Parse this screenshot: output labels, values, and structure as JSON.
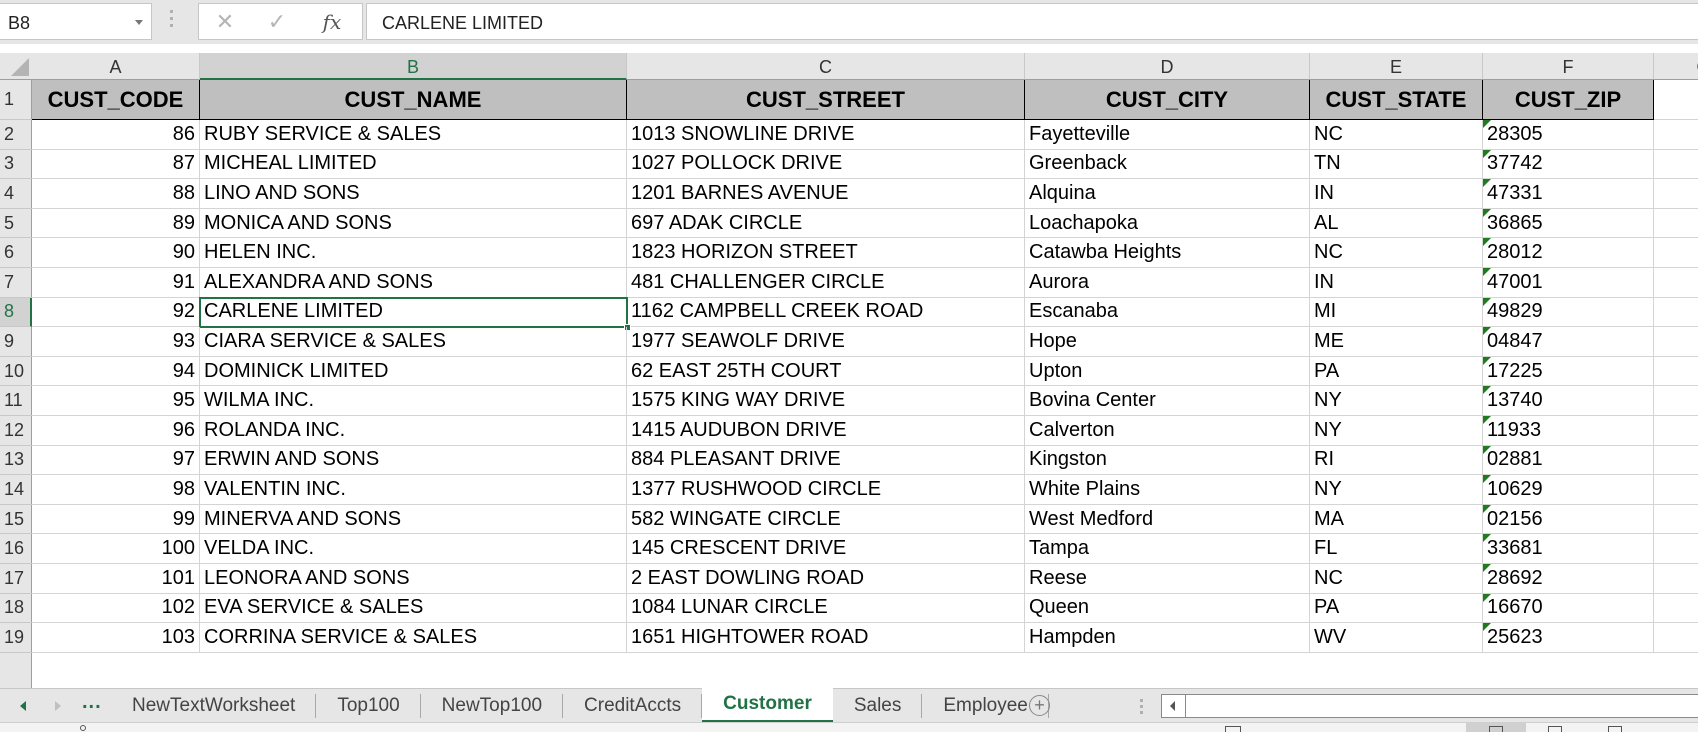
{
  "formula_bar": {
    "name_box": "B8",
    "cancel_icon": "✕",
    "enter_icon": "✓",
    "fx_label": "fx",
    "formula_value": "CARLENE LIMITED"
  },
  "grid": {
    "columns": [
      "A",
      "B",
      "C",
      "D",
      "E",
      "F",
      "G"
    ],
    "active_column": "B",
    "active_row": "8",
    "headers": [
      "CUST_CODE",
      "CUST_NAME",
      "CUST_STREET",
      "CUST_CITY",
      "CUST_STATE",
      "CUST_ZIP"
    ],
    "rows": [
      {
        "row": "2",
        "code": "86",
        "name": "RUBY SERVICE & SALES",
        "street": "1013 SNOWLINE DRIVE",
        "city": "Fayetteville",
        "state": "NC",
        "zip": "28305"
      },
      {
        "row": "3",
        "code": "87",
        "name": "MICHEAL LIMITED",
        "street": "1027 POLLOCK DRIVE",
        "city": "Greenback",
        "state": "TN",
        "zip": "37742"
      },
      {
        "row": "4",
        "code": "88",
        "name": "LINO AND SONS",
        "street": "1201 BARNES AVENUE",
        "city": "Alquina",
        "state": "IN",
        "zip": "47331"
      },
      {
        "row": "5",
        "code": "89",
        "name": "MONICA AND SONS",
        "street": "697 ADAK CIRCLE",
        "city": "Loachapoka",
        "state": "AL",
        "zip": "36865"
      },
      {
        "row": "6",
        "code": "90",
        "name": "HELEN INC.",
        "street": "1823 HORIZON STREET",
        "city": "Catawba Heights",
        "state": "NC",
        "zip": "28012"
      },
      {
        "row": "7",
        "code": "91",
        "name": "ALEXANDRA AND SONS",
        "street": "481 CHALLENGER CIRCLE",
        "city": "Aurora",
        "state": "IN",
        "zip": "47001"
      },
      {
        "row": "8",
        "code": "92",
        "name": "CARLENE LIMITED",
        "street": "1162 CAMPBELL CREEK ROAD",
        "city": "Escanaba",
        "state": "MI",
        "zip": "49829"
      },
      {
        "row": "9",
        "code": "93",
        "name": "CIARA SERVICE & SALES",
        "street": "1977 SEAWOLF DRIVE",
        "city": "Hope",
        "state": "ME",
        "zip": "04847"
      },
      {
        "row": "10",
        "code": "94",
        "name": "DOMINICK LIMITED",
        "street": "62 EAST 25TH COURT",
        "city": "Upton",
        "state": "PA",
        "zip": "17225"
      },
      {
        "row": "11",
        "code": "95",
        "name": "WILMA INC.",
        "street": "1575 KING WAY DRIVE",
        "city": "Bovina Center",
        "state": "NY",
        "zip": "13740"
      },
      {
        "row": "12",
        "code": "96",
        "name": "ROLANDA INC.",
        "street": "1415 AUDUBON DRIVE",
        "city": "Calverton",
        "state": "NY",
        "zip": "11933"
      },
      {
        "row": "13",
        "code": "97",
        "name": "ERWIN AND SONS",
        "street": "884 PLEASANT DRIVE",
        "city": "Kingston",
        "state": "RI",
        "zip": "02881"
      },
      {
        "row": "14",
        "code": "98",
        "name": "VALENTIN INC.",
        "street": "1377 RUSHWOOD CIRCLE",
        "city": "White Plains",
        "state": "NY",
        "zip": "10629"
      },
      {
        "row": "15",
        "code": "99",
        "name": "MINERVA AND SONS",
        "street": "582 WINGATE CIRCLE",
        "city": "West Medford",
        "state": "MA",
        "zip": "02156"
      },
      {
        "row": "16",
        "code": "100",
        "name": "VELDA INC.",
        "street": "145 CRESCENT DRIVE",
        "city": "Tampa",
        "state": "FL",
        "zip": "33681"
      },
      {
        "row": "17",
        "code": "101",
        "name": "LEONORA AND SONS",
        "street": "2 EAST DOWLING ROAD",
        "city": "Reese",
        "state": "NC",
        "zip": "28692"
      },
      {
        "row": "18",
        "code": "102",
        "name": "EVA SERVICE & SALES",
        "street": "1084 LUNAR CIRCLE",
        "city": "Queen",
        "state": "PA",
        "zip": "16670"
      },
      {
        "row": "19",
        "code": "103",
        "name": "CORRINA SERVICE & SALES",
        "street": "1651 HIGHTOWER ROAD",
        "city": "Hampden",
        "state": "WV",
        "zip": "25623"
      }
    ]
  },
  "sheet_tabs": {
    "more_label": "...",
    "add_label": "+",
    "tabs": [
      {
        "label": "NewTextWorksheet",
        "active": false
      },
      {
        "label": "Top100",
        "active": false
      },
      {
        "label": "NewTop100",
        "active": false
      },
      {
        "label": "CreditAccts",
        "active": false
      },
      {
        "label": "Customer",
        "active": true
      },
      {
        "label": "Sales",
        "active": false
      },
      {
        "label": "Employee",
        "active": false
      }
    ]
  },
  "colors": {
    "accent": "#217346",
    "header_fill": "#bfbfbf",
    "error_indicator": "#1e7b1e"
  }
}
